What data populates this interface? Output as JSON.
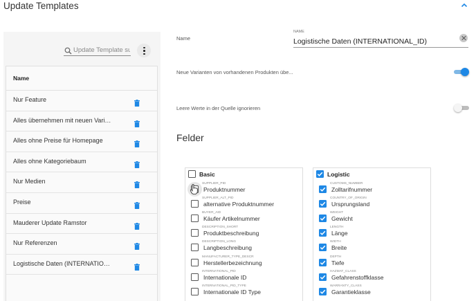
{
  "header": {
    "title": "Update Templates",
    "collapse_icon": "chevron-up-icon"
  },
  "sidebar": {
    "search_placeholder": "Update Template su...",
    "list_header": "Name",
    "items": [
      {
        "label": "Nur Feature"
      },
      {
        "label": "Alles übernehmen mit neuen Variant..."
      },
      {
        "label": "Alles ohne Preise für Homepage"
      },
      {
        "label": "Alles ohne Kategoriebaum"
      },
      {
        "label": "Nur Medien"
      },
      {
        "label": "Preise"
      },
      {
        "label": "Mauderer Update Ramstor"
      },
      {
        "label": "Nur Referenzen"
      },
      {
        "label": "Logistische Daten (INTERNATIONAL..."
      }
    ]
  },
  "form": {
    "name_label": "Name",
    "name_small_label": "NAME",
    "name_value": "Logistische Daten (INTERNATIONAL_ID)",
    "variants_label": "Neue Varianten von vorhandenen Produkten übe...",
    "variants_on": true,
    "ignore_empty_label": "Leere Werte in der Quelle ignorieren",
    "ignore_empty_on": false,
    "felder_title": "Felder"
  },
  "groups": {
    "basic": {
      "title": "Basic",
      "checked": false,
      "items": [
        {
          "key": "SUPPLIER_PID",
          "label": "Produktnummer",
          "checked": false
        },
        {
          "key": "SUPPLIER_ALT_PID",
          "label": "alternative Produktnummer",
          "checked": false
        },
        {
          "key": "BUYER_AID",
          "label": "Käufer Artikelnummer",
          "checked": false
        },
        {
          "key": "DESCRIPTION_SHORT",
          "label": "Produktbeschreibung",
          "checked": false
        },
        {
          "key": "DESCRIPTION_LONG",
          "label": "Langbeschreibung",
          "checked": false
        },
        {
          "key": "MANUFACTURER_TYPE_DESCR",
          "label": "Herstellerbezeichnung",
          "checked": false
        },
        {
          "key": "INTERNATIONAL_PID",
          "label": "Internationale ID",
          "checked": false
        },
        {
          "key": "INTERNATIONAL_PID_TYPE",
          "label": "Internationale ID Type",
          "checked": false
        }
      ]
    },
    "logistic": {
      "title": "Logistic",
      "checked": true,
      "items": [
        {
          "key": "CUSTOMS_NUMBER",
          "label": "Zolltarifnummer",
          "checked": true
        },
        {
          "key": "COUNTRY_OF_ORIGIN",
          "label": "Ursprungsland",
          "checked": true
        },
        {
          "key": "WEIGHT",
          "label": "Gewicht",
          "checked": true
        },
        {
          "key": "LENGTH",
          "label": "Länge",
          "checked": true
        },
        {
          "key": "WIDTH",
          "label": "Breite",
          "checked": true
        },
        {
          "key": "DEPTH",
          "label": "Tiefe",
          "checked": true
        },
        {
          "key": "HAZMAT_CLASS",
          "label": "Gefahrenstoffklasse",
          "checked": true
        },
        {
          "key": "WARRANTY_CLASS",
          "label": "Garantieklasse",
          "checked": true
        }
      ]
    }
  },
  "colors": {
    "accent": "#1e88e5",
    "toggle_track_on": "#7fb8e6",
    "panel_bg": "#f5f5f5"
  }
}
